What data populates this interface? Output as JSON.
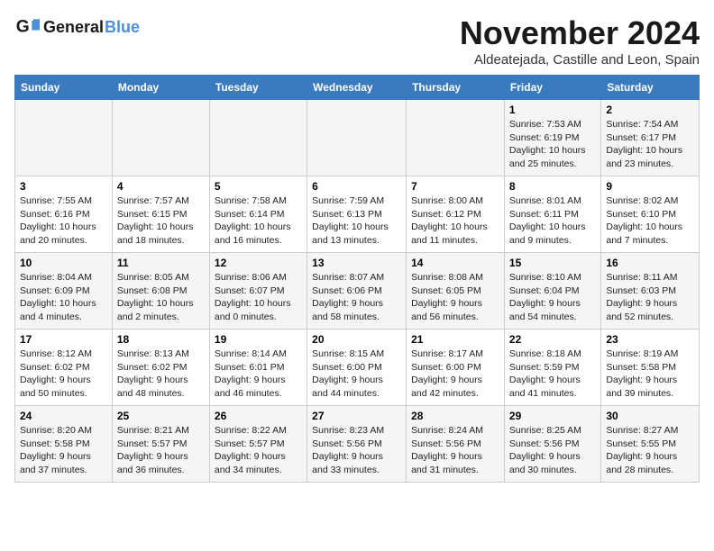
{
  "logo": {
    "line1": "General",
    "line2": "Blue"
  },
  "title": "November 2024",
  "location": "Aldeatejada, Castille and Leon, Spain",
  "weekdays": [
    "Sunday",
    "Monday",
    "Tuesday",
    "Wednesday",
    "Thursday",
    "Friday",
    "Saturday"
  ],
  "weeks": [
    [
      {
        "day": "",
        "info": ""
      },
      {
        "day": "",
        "info": ""
      },
      {
        "day": "",
        "info": ""
      },
      {
        "day": "",
        "info": ""
      },
      {
        "day": "",
        "info": ""
      },
      {
        "day": "1",
        "info": "Sunrise: 7:53 AM\nSunset: 6:19 PM\nDaylight: 10 hours and 25 minutes."
      },
      {
        "day": "2",
        "info": "Sunrise: 7:54 AM\nSunset: 6:17 PM\nDaylight: 10 hours and 23 minutes."
      }
    ],
    [
      {
        "day": "3",
        "info": "Sunrise: 7:55 AM\nSunset: 6:16 PM\nDaylight: 10 hours and 20 minutes."
      },
      {
        "day": "4",
        "info": "Sunrise: 7:57 AM\nSunset: 6:15 PM\nDaylight: 10 hours and 18 minutes."
      },
      {
        "day": "5",
        "info": "Sunrise: 7:58 AM\nSunset: 6:14 PM\nDaylight: 10 hours and 16 minutes."
      },
      {
        "day": "6",
        "info": "Sunrise: 7:59 AM\nSunset: 6:13 PM\nDaylight: 10 hours and 13 minutes."
      },
      {
        "day": "7",
        "info": "Sunrise: 8:00 AM\nSunset: 6:12 PM\nDaylight: 10 hours and 11 minutes."
      },
      {
        "day": "8",
        "info": "Sunrise: 8:01 AM\nSunset: 6:11 PM\nDaylight: 10 hours and 9 minutes."
      },
      {
        "day": "9",
        "info": "Sunrise: 8:02 AM\nSunset: 6:10 PM\nDaylight: 10 hours and 7 minutes."
      }
    ],
    [
      {
        "day": "10",
        "info": "Sunrise: 8:04 AM\nSunset: 6:09 PM\nDaylight: 10 hours and 4 minutes."
      },
      {
        "day": "11",
        "info": "Sunrise: 8:05 AM\nSunset: 6:08 PM\nDaylight: 10 hours and 2 minutes."
      },
      {
        "day": "12",
        "info": "Sunrise: 8:06 AM\nSunset: 6:07 PM\nDaylight: 10 hours and 0 minutes."
      },
      {
        "day": "13",
        "info": "Sunrise: 8:07 AM\nSunset: 6:06 PM\nDaylight: 9 hours and 58 minutes."
      },
      {
        "day": "14",
        "info": "Sunrise: 8:08 AM\nSunset: 6:05 PM\nDaylight: 9 hours and 56 minutes."
      },
      {
        "day": "15",
        "info": "Sunrise: 8:10 AM\nSunset: 6:04 PM\nDaylight: 9 hours and 54 minutes."
      },
      {
        "day": "16",
        "info": "Sunrise: 8:11 AM\nSunset: 6:03 PM\nDaylight: 9 hours and 52 minutes."
      }
    ],
    [
      {
        "day": "17",
        "info": "Sunrise: 8:12 AM\nSunset: 6:02 PM\nDaylight: 9 hours and 50 minutes."
      },
      {
        "day": "18",
        "info": "Sunrise: 8:13 AM\nSunset: 6:02 PM\nDaylight: 9 hours and 48 minutes."
      },
      {
        "day": "19",
        "info": "Sunrise: 8:14 AM\nSunset: 6:01 PM\nDaylight: 9 hours and 46 minutes."
      },
      {
        "day": "20",
        "info": "Sunrise: 8:15 AM\nSunset: 6:00 PM\nDaylight: 9 hours and 44 minutes."
      },
      {
        "day": "21",
        "info": "Sunrise: 8:17 AM\nSunset: 6:00 PM\nDaylight: 9 hours and 42 minutes."
      },
      {
        "day": "22",
        "info": "Sunrise: 8:18 AM\nSunset: 5:59 PM\nDaylight: 9 hours and 41 minutes."
      },
      {
        "day": "23",
        "info": "Sunrise: 8:19 AM\nSunset: 5:58 PM\nDaylight: 9 hours and 39 minutes."
      }
    ],
    [
      {
        "day": "24",
        "info": "Sunrise: 8:20 AM\nSunset: 5:58 PM\nDaylight: 9 hours and 37 minutes."
      },
      {
        "day": "25",
        "info": "Sunrise: 8:21 AM\nSunset: 5:57 PM\nDaylight: 9 hours and 36 minutes."
      },
      {
        "day": "26",
        "info": "Sunrise: 8:22 AM\nSunset: 5:57 PM\nDaylight: 9 hours and 34 minutes."
      },
      {
        "day": "27",
        "info": "Sunrise: 8:23 AM\nSunset: 5:56 PM\nDaylight: 9 hours and 33 minutes."
      },
      {
        "day": "28",
        "info": "Sunrise: 8:24 AM\nSunset: 5:56 PM\nDaylight: 9 hours and 31 minutes."
      },
      {
        "day": "29",
        "info": "Sunrise: 8:25 AM\nSunset: 5:56 PM\nDaylight: 9 hours and 30 minutes."
      },
      {
        "day": "30",
        "info": "Sunrise: 8:27 AM\nSunset: 5:55 PM\nDaylight: 9 hours and 28 minutes."
      }
    ]
  ]
}
